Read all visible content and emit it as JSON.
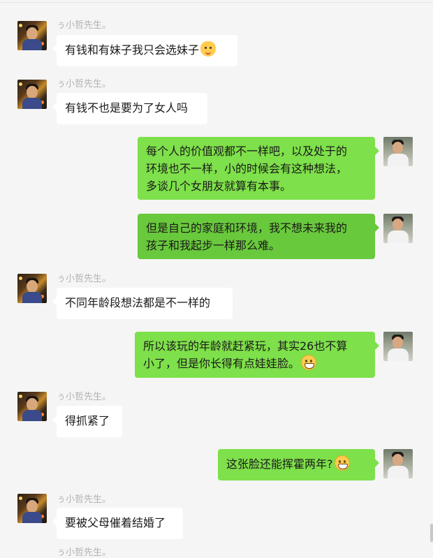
{
  "contact": {
    "nickname": "ぅ小哲先生。"
  },
  "messages": [
    {
      "id": 1,
      "side": "left",
      "text": "有钱和有妹子我只会选妹子",
      "emoji": "cat-face-icon"
    },
    {
      "id": 2,
      "side": "left",
      "text": "有钱不也是要为了女人吗"
    },
    {
      "id": 3,
      "side": "right",
      "lines": [
        "每个人的价值观都不一样吧，以及处于的",
        "环境也不一样，小的时候会有这种想法，",
        "多谈几个女朋友就算有本事。"
      ]
    },
    {
      "id": 4,
      "side": "right",
      "lines": [
        "但是自己的家庭和环境，我不想未来我的",
        "孩子和我起步一样那么难。"
      ]
    },
    {
      "id": 5,
      "side": "left",
      "text": "不同年龄段想法都是不一样的"
    },
    {
      "id": 6,
      "side": "right",
      "lines": [
        "所以该玩的年龄就赶紧玩，其实26也不算",
        "小了，但是你长得有点娃娃脸。"
      ],
      "emoji": "grinning-face-icon"
    },
    {
      "id": 7,
      "side": "left",
      "text": "得抓紧了"
    },
    {
      "id": 8,
      "side": "right",
      "text": "这张脸还能挥霍两年?",
      "emoji": "grinning-face-icon"
    },
    {
      "id": 9,
      "side": "left",
      "text": "要被父母催着结婚了"
    }
  ],
  "colors": {
    "sent_bubble": "#7ee04a",
    "received_bubble": "#ffffff",
    "background": "#f5f5f5",
    "nickname": "#b2b2b2"
  }
}
